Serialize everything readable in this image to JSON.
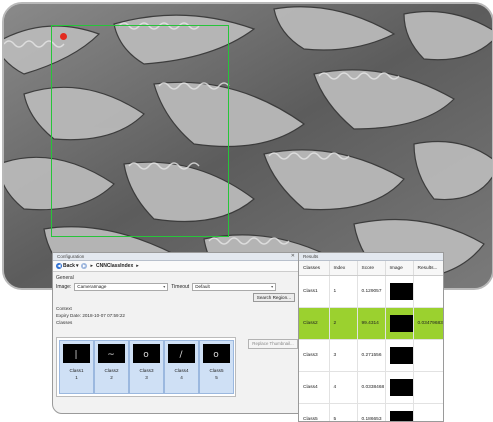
{
  "colors": {
    "roi": "#27c43a",
    "roi_marker": "#e32b1f",
    "selected_row": "#9bd12f",
    "class_card": "#cfe0f5"
  },
  "config": {
    "title": "Configuration",
    "close_icon": "close-icon",
    "nav": {
      "back_label": "Back",
      "path_label": "CNNClassIndex"
    },
    "general_label": "General",
    "image_label": "Image:",
    "image_value": "CameraImage",
    "timeout_label": "Timeout",
    "timeout_value": "Default",
    "search_region_label": "Search Region...",
    "context_label": "Context",
    "expiry_label": "Expiry Date:",
    "expiry_value": "2018-10-07 07:59:22",
    "classes_label": "Classes",
    "classes": [
      {
        "name": "Class1",
        "index": "1",
        "glyph": "|"
      },
      {
        "name": "Class2",
        "index": "2",
        "glyph": "~"
      },
      {
        "name": "Class3",
        "index": "3",
        "glyph": "o"
      },
      {
        "name": "Class4",
        "index": "4",
        "glyph": "/"
      },
      {
        "name": "Class5",
        "index": "5",
        "glyph": "o"
      }
    ],
    "replace_thumbnail_label": "Replace Thumbnail..."
  },
  "results": {
    "title": "Results",
    "columns": [
      "Classes",
      "Index",
      "Score",
      "Image",
      "Results..."
    ],
    "rows": [
      {
        "class": "Class1",
        "index": "1",
        "score": "0.129057",
        "extra": "",
        "selected": false
      },
      {
        "class": "Class2",
        "index": "2",
        "score": "99.4314",
        "extra": "0.034796836",
        "selected": true
      },
      {
        "class": "Class3",
        "index": "3",
        "score": "0.271556",
        "extra": "",
        "selected": false
      },
      {
        "class": "Class4",
        "index": "4",
        "score": "0.0338468",
        "extra": "",
        "selected": false
      },
      {
        "class": "Class5",
        "index": "5",
        "score": "0.186653",
        "extra": "",
        "selected": false
      }
    ]
  }
}
